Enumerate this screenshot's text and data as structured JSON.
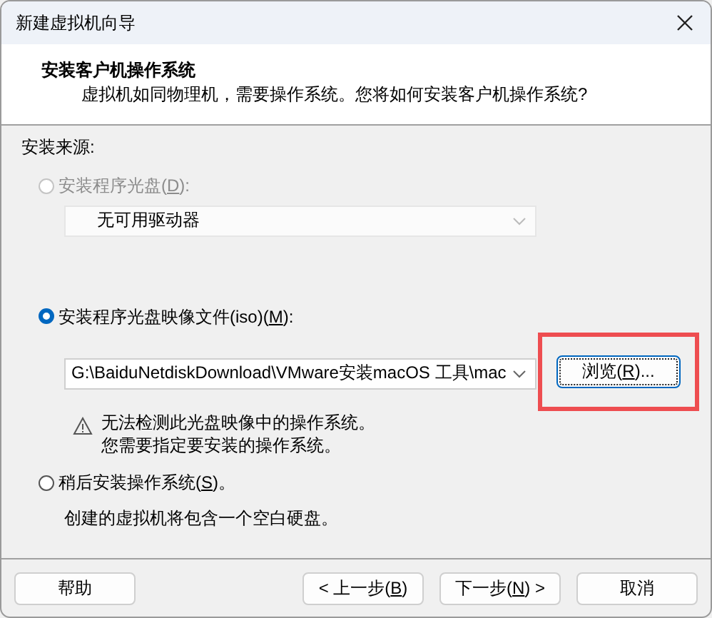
{
  "window": {
    "title": "新建虚拟机向导"
  },
  "header": {
    "title": "安装客户机操作系统",
    "subtitle": "虚拟机如同物理机，需要操作系统。您将如何安装客户机操作系统?"
  },
  "section_label": "安装来源:",
  "options": [
    {
      "kind": "drive",
      "label_before": "安装程序光盘(",
      "access_key": "D",
      "label_after": "):",
      "selected": false,
      "disabled": true,
      "dropdown": {
        "value": "无可用驱动器",
        "disabled": true
      }
    },
    {
      "kind": "iso",
      "label_before": "安装程序光盘映像文件(iso)(",
      "access_key": "M",
      "label_after": "):",
      "selected": true,
      "disabled": false,
      "dropdown": {
        "value": "G:\\BaiduNetdiskDownload\\VMware安装macOS 工具\\mac",
        "disabled": false
      },
      "browse": {
        "label_before": "浏览(",
        "access_key": "R",
        "label_after": ")...",
        "highlighted": true
      },
      "warning": [
        "无法检测此光盘映像中的操作系统。",
        "您需要指定要安装的操作系统。"
      ]
    },
    {
      "kind": "later",
      "label_before": "稍后安装操作系统(",
      "access_key": "S",
      "label_after": ")。",
      "selected": false,
      "disabled": false,
      "note": "创建的虚拟机将包含一个空白硬盘。"
    }
  ],
  "buttons": [
    {
      "kind": "help",
      "label_before": "帮助"
    },
    {
      "kind": "back",
      "label_before": "< 上一步(",
      "access_key": "B",
      "label_after": ")"
    },
    {
      "kind": "next",
      "label_before": "下一步(",
      "access_key": "N",
      "label_after": ") >"
    },
    {
      "kind": "cancel",
      "label_before": "取消"
    }
  ]
}
